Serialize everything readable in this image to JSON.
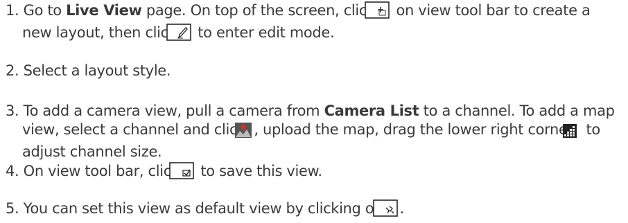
{
  "steps": [
    {
      "number": "1.",
      "parts": [
        "Go to ",
        "Live View",
        " page. On top of the screen, click ",
        " on view tool bar to create a new layout, then click ",
        " to enter edit mode."
      ],
      "icons": [
        "new-layout-icon",
        "edit-mode-icon"
      ]
    },
    {
      "number": "2.",
      "text": "Select a layout style."
    },
    {
      "number": "3.",
      "parts": [
        "To add a camera view, pull a camera from ",
        "Camera List",
        " to a channel. To add a map view, select a channel and click ",
        ", upload the map, drag the lower right corner ",
        " to adjust channel size."
      ],
      "icons": [
        "map-view-icon",
        "resize-corner-icon"
      ]
    },
    {
      "number": "4.",
      "parts": [
        "On view tool bar, click ",
        " to save this view."
      ],
      "icons": [
        "save-view-icon"
      ]
    },
    {
      "number": "5.",
      "parts": [
        "You can set this view as default view by clicking on ",
        "."
      ],
      "icons": [
        "set-default-view-icon"
      ]
    }
  ],
  "colors": {
    "text": "#3a3a3a",
    "icon_border": "#1a1a1a",
    "map_pin": "#c0392b"
  }
}
